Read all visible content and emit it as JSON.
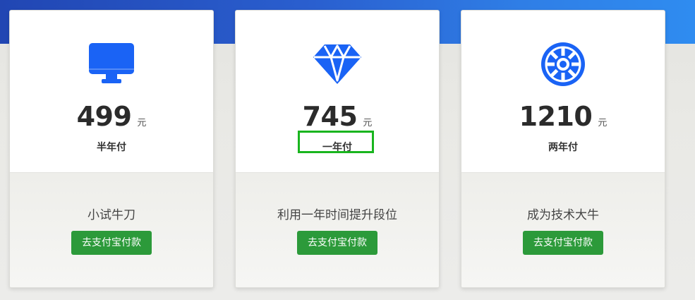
{
  "accent_color": "#1a63f5",
  "button_color": "#2c9a3a",
  "highlight_color": "#19b51e",
  "plans": [
    {
      "icon": "monitor-icon",
      "price": "499",
      "unit": "元",
      "period": "半年付",
      "tagline": "小试牛刀",
      "button_label": "去支付宝付款"
    },
    {
      "icon": "diamond-icon",
      "price": "745",
      "unit": "元",
      "period": "一年付",
      "tagline": "利用一年时间提升段位",
      "button_label": "去支付宝付款"
    },
    {
      "icon": "empire-icon",
      "price": "1210",
      "unit": "元",
      "period": "两年付",
      "tagline": "成为技术大牛",
      "button_label": "去支付宝付款"
    }
  ]
}
